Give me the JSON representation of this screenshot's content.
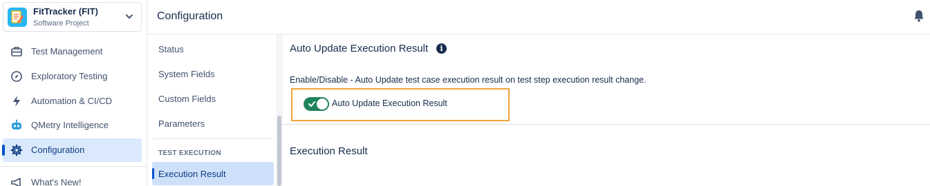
{
  "project": {
    "name": "FitTracker (FIT)",
    "type": "Software Project"
  },
  "sidebar": {
    "items": [
      {
        "label": "Test Management",
        "icon": "toolbox-icon"
      },
      {
        "label": "Exploratory Testing",
        "icon": "compass-icon"
      },
      {
        "label": "Automation & CI/CD",
        "icon": "lightning-icon"
      },
      {
        "label": "QMetry Intelligence",
        "icon": "robot-icon"
      },
      {
        "label": "Configuration",
        "icon": "gear-icon",
        "active": true
      },
      {
        "label": "What's New!",
        "icon": "megaphone-icon"
      }
    ]
  },
  "header": {
    "title": "Configuration"
  },
  "config_nav": {
    "items": [
      {
        "label": "Status"
      },
      {
        "label": "System Fields"
      },
      {
        "label": "Custom Fields"
      },
      {
        "label": "Parameters"
      }
    ],
    "group_heading": "TEST EXECUTION",
    "group_items": [
      {
        "label": "Execution Result",
        "active": true
      }
    ]
  },
  "main": {
    "section_title": "Auto Update Execution Result",
    "description": "Enable/Disable - Auto Update test case execution result on test step execution result change.",
    "toggle": {
      "label": "Auto Update Execution Result",
      "enabled": true
    },
    "section_title_2": "Execution Result"
  },
  "colors": {
    "accent": "#0052cc",
    "toggle_on": "#1f845a",
    "highlight": "#f0a33a",
    "active_bg": "#dbe9fd"
  }
}
